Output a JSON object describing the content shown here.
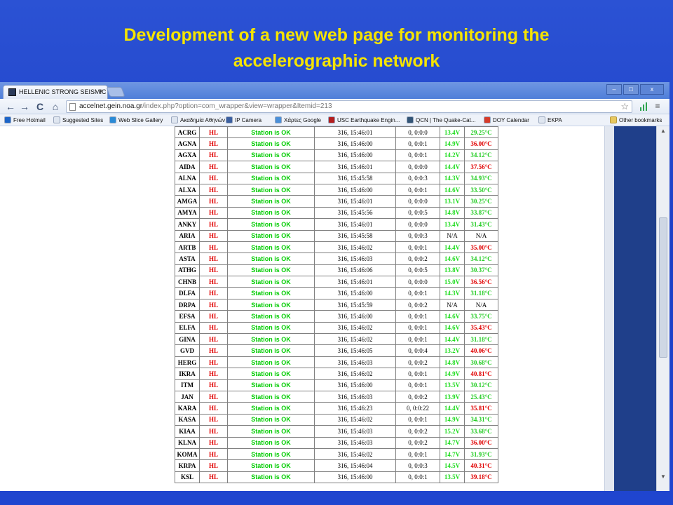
{
  "slide": {
    "title_line1": "Development of a new web page for monitoring the",
    "title_line2": "accelerographic network"
  },
  "browser": {
    "tab_title": "HELLENIC STRONG SEISMIC",
    "tab_close": "×",
    "window_buttons": {
      "minimize": "–",
      "maximize": "□",
      "close": "x"
    },
    "nav": {
      "back": "←",
      "forward": "→",
      "reload": "C",
      "home": "⌂"
    },
    "url_host": "accelnet.gein.noa.gr",
    "url_path": "/index.php?option=com_wrapper&view=wrapper&Itemid=213",
    "star": "☆",
    "menu": "≡",
    "bookmarks": [
      {
        "label": "Free Hotmail",
        "color": "#1b64c8"
      },
      {
        "label": "Suggested Sites",
        "color": "#dfe6f0"
      },
      {
        "label": "Web Slice Gallery",
        "color": "#2a8ad6"
      },
      {
        "label": "Ακαδημία Αθηνών",
        "color": "#dfe6f0"
      },
      {
        "label": "IP Camera",
        "color": "#3b5fa0"
      },
      {
        "label": "Χάρτες Google",
        "color": "#4a90d9"
      },
      {
        "label": "USC Earthquake Engin...",
        "color": "#b41e1e"
      },
      {
        "label": "QCN | The Quake-Cat...",
        "color": "#335577"
      },
      {
        "label": "DOY Calendar",
        "color": "#d63b2a"
      },
      {
        "label": "EKPA",
        "color": "#dfe6f0"
      }
    ],
    "other_bookmarks": "Other bookmarks",
    "accent": "#3c6bd0"
  },
  "stations": [
    {
      "code": "ACRG",
      "net": "HL",
      "status": "Station is OK",
      "time": "316, 15:46:01",
      "count": "0, 0:0:0",
      "volt": "13.4V",
      "temp": "29.25°C",
      "temp_color": "green"
    },
    {
      "code": "AGNA",
      "net": "HL",
      "status": "Station is OK",
      "time": "316, 15:46:00",
      "count": "0, 0:0:1",
      "volt": "14.9V",
      "temp": "36.00°C",
      "temp_color": "red"
    },
    {
      "code": "AGXA",
      "net": "HL",
      "status": "Station is OK",
      "time": "316, 15:46:00",
      "count": "0, 0:0:1",
      "volt": "14.2V",
      "temp": "34.12°C",
      "temp_color": "green"
    },
    {
      "code": "AIDA",
      "net": "HL",
      "status": "Station is OK",
      "time": "316, 15:46:01",
      "count": "0, 0:0:0",
      "volt": "14.4V",
      "temp": "37.56°C",
      "temp_color": "red"
    },
    {
      "code": "ALNA",
      "net": "HL",
      "status": "Station is OK",
      "time": "316, 15:45:58",
      "count": "0, 0:0:3",
      "volt": "14.3V",
      "temp": "34.93°C",
      "temp_color": "green"
    },
    {
      "code": "ALXA",
      "net": "HL",
      "status": "Station is OK",
      "time": "316, 15:46:00",
      "count": "0, 0:0:1",
      "volt": "14.6V",
      "temp": "33.50°C",
      "temp_color": "green"
    },
    {
      "code": "AMGA",
      "net": "HL",
      "status": "Station is OK",
      "time": "316, 15:46:01",
      "count": "0, 0:0:0",
      "volt": "13.1V",
      "temp": "30.25°C",
      "temp_color": "green"
    },
    {
      "code": "AMYA",
      "net": "HL",
      "status": "Station is OK",
      "time": "316, 15:45:56",
      "count": "0, 0:0:5",
      "volt": "14.8V",
      "temp": "33.87°C",
      "temp_color": "green"
    },
    {
      "code": "ANKY",
      "net": "HL",
      "status": "Station is OK",
      "time": "316, 15:46:01",
      "count": "0, 0:0:0",
      "volt": "13.4V",
      "temp": "31.43°C",
      "temp_color": "green"
    },
    {
      "code": "ARIA",
      "net": "HL",
      "status": "Station is OK",
      "time": "316, 15:45:58",
      "count": "0, 0:0:3",
      "volt": "N/A",
      "temp": "N/A",
      "temp_color": "na"
    },
    {
      "code": "ARTB",
      "net": "HL",
      "status": "Station is OK",
      "time": "316, 15:46:02",
      "count": "0, 0:0:1",
      "volt": "14.4V",
      "temp": "35.00°C",
      "temp_color": "red"
    },
    {
      "code": "ASTA",
      "net": "HL",
      "status": "Station is OK",
      "time": "316, 15:46:03",
      "count": "0, 0:0:2",
      "volt": "14.6V",
      "temp": "34.12°C",
      "temp_color": "green"
    },
    {
      "code": "ATHG",
      "net": "HL",
      "status": "Station is OK",
      "time": "316, 15:46:06",
      "count": "0, 0:0:5",
      "volt": "13.8V",
      "temp": "30.37°C",
      "temp_color": "green"
    },
    {
      "code": "CHNB",
      "net": "HL",
      "status": "Station is OK",
      "time": "316, 15:46:01",
      "count": "0, 0:0:0",
      "volt": "15.0V",
      "temp": "36.56°C",
      "temp_color": "red"
    },
    {
      "code": "DLFA",
      "net": "HL",
      "status": "Station is OK",
      "time": "316, 15:46:00",
      "count": "0, 0:0:1",
      "volt": "14.3V",
      "temp": "31.18°C",
      "temp_color": "green"
    },
    {
      "code": "DRPA",
      "net": "HL",
      "status": "Station is OK",
      "time": "316, 15:45:59",
      "count": "0, 0:0:2",
      "volt": "N/A",
      "temp": "N/A",
      "temp_color": "na"
    },
    {
      "code": "EFSA",
      "net": "HL",
      "status": "Station is OK",
      "time": "316, 15:46:00",
      "count": "0, 0:0:1",
      "volt": "14.6V",
      "temp": "33.75°C",
      "temp_color": "green"
    },
    {
      "code": "ELFA",
      "net": "HL",
      "status": "Station is OK",
      "time": "316, 15:46:02",
      "count": "0, 0:0:1",
      "volt": "14.6V",
      "temp": "35.43°C",
      "temp_color": "red"
    },
    {
      "code": "GINA",
      "net": "HL",
      "status": "Station is OK",
      "time": "316, 15:46:02",
      "count": "0, 0:0:1",
      "volt": "14.4V",
      "temp": "31.18°C",
      "temp_color": "green"
    },
    {
      "code": "GVD",
      "net": "HL",
      "status": "Station is OK",
      "time": "316, 15:46:05",
      "count": "0, 0:0:4",
      "volt": "13.2V",
      "temp": "40.06°C",
      "temp_color": "red"
    },
    {
      "code": "HERG",
      "net": "HL",
      "status": "Station is OK",
      "time": "316, 15:46:03",
      "count": "0, 0:0:2",
      "volt": "14.8V",
      "temp": "30.68°C",
      "temp_color": "green"
    },
    {
      "code": "IKRA",
      "net": "HL",
      "status": "Station is OK",
      "time": "316, 15:46:02",
      "count": "0, 0:0:1",
      "volt": "14.9V",
      "temp": "40.81°C",
      "temp_color": "red"
    },
    {
      "code": "ITM",
      "net": "HL",
      "status": "Station is OK",
      "time": "316, 15:46:00",
      "count": "0, 0:0:1",
      "volt": "13.5V",
      "temp": "30.12°C",
      "temp_color": "green"
    },
    {
      "code": "JAN",
      "net": "HL",
      "status": "Station is OK",
      "time": "316, 15:46:03",
      "count": "0, 0:0:2",
      "volt": "13.9V",
      "temp": "25.43°C",
      "temp_color": "green"
    },
    {
      "code": "KARA",
      "net": "HL",
      "status": "Station is OK",
      "time": "316, 15:46:23",
      "count": "0, 0:0:22",
      "volt": "14.4V",
      "temp": "35.81°C",
      "temp_color": "red"
    },
    {
      "code": "KASA",
      "net": "HL",
      "status": "Station is OK",
      "time": "316, 15:46:02",
      "count": "0, 0:0:1",
      "volt": "14.9V",
      "temp": "34.31°C",
      "temp_color": "green"
    },
    {
      "code": "KIAA",
      "net": "HL",
      "status": "Station is OK",
      "time": "316, 15:46:03",
      "count": "0, 0:0:2",
      "volt": "15.2V",
      "temp": "33.68°C",
      "temp_color": "green"
    },
    {
      "code": "KLNA",
      "net": "HL",
      "status": "Station is OK",
      "time": "316, 15:46:03",
      "count": "0, 0:0:2",
      "volt": "14.7V",
      "temp": "36.00°C",
      "temp_color": "red"
    },
    {
      "code": "KOMA",
      "net": "HL",
      "status": "Station is OK",
      "time": "316, 15:46:02",
      "count": "0, 0:0:1",
      "volt": "14.7V",
      "temp": "31.93°C",
      "temp_color": "green"
    },
    {
      "code": "KRPA",
      "net": "HL",
      "status": "Station is OK",
      "time": "316, 15:46:04",
      "count": "0, 0:0:3",
      "volt": "14.5V",
      "temp": "40.31°C",
      "temp_color": "red"
    },
    {
      "code": "KSL",
      "net": "HL",
      "status": "Station is OK",
      "time": "316, 15:46:00",
      "count": "0, 0:0:1",
      "volt": "13.5V",
      "temp": "39.18°C",
      "temp_color": "red"
    }
  ]
}
